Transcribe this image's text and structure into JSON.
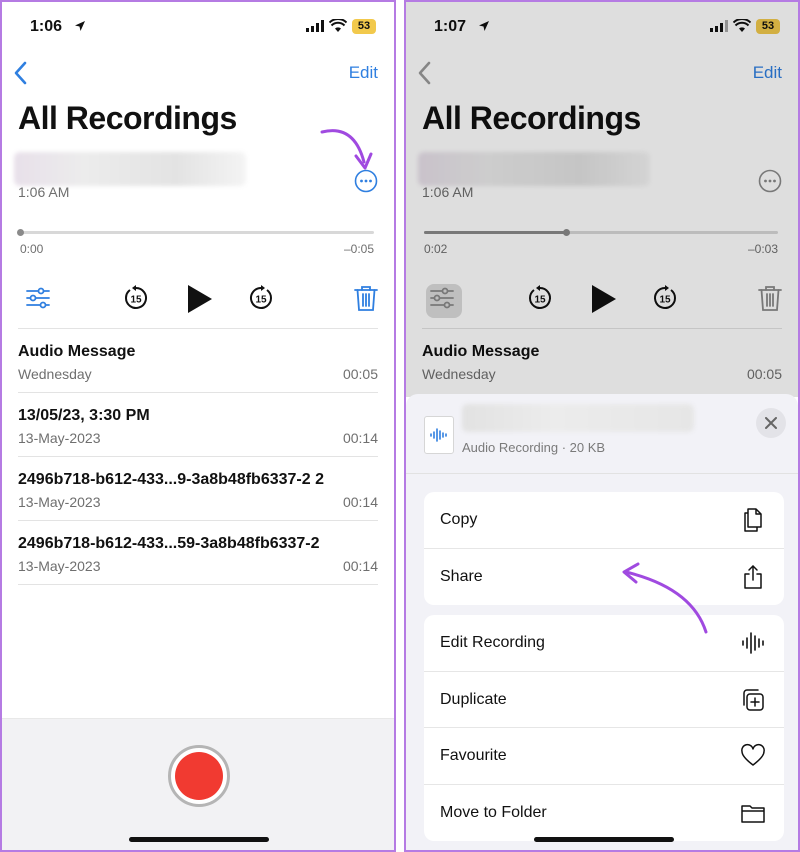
{
  "colors": {
    "accent": "#2f7fe0",
    "record": "#f13a31",
    "annotation": "#a04ae0",
    "battery": "#f2c94c"
  },
  "left": {
    "status": {
      "time": "1:06",
      "battery": "53"
    },
    "nav": {
      "edit_label": "Edit"
    },
    "title": "All Recordings",
    "current": {
      "time": "1:06 AM",
      "elapsed": "0:00",
      "remaining": "–0:05",
      "progress": 0
    },
    "recordings": [
      {
        "name": "Audio Message",
        "date": "Wednesday",
        "duration": "00:05"
      },
      {
        "name": "13/05/23, 3:30 PM",
        "date": "13-May-2023",
        "duration": "00:14"
      },
      {
        "name": "2496b718-b612-433...9-3a8b48fb6337-2 2",
        "date": "13-May-2023",
        "duration": "00:14"
      },
      {
        "name": "2496b718-b612-433...59-3a8b48fb6337-2",
        "date": "13-May-2023",
        "duration": "00:14"
      }
    ]
  },
  "right": {
    "status": {
      "time": "1:07",
      "battery": "53"
    },
    "nav": {
      "edit_label": "Edit"
    },
    "title": "All Recordings",
    "current": {
      "time": "1:06 AM",
      "elapsed": "0:02",
      "remaining": "–0:03",
      "progress": 0.4
    },
    "recordings": [
      {
        "name": "Audio Message",
        "date": "Wednesday",
        "duration": "00:05"
      }
    ],
    "sheet": {
      "file_meta": "Audio Recording · 20 KB",
      "group1": [
        {
          "label": "Copy",
          "icon": "copy-icon"
        },
        {
          "label": "Share",
          "icon": "share-icon"
        }
      ],
      "group2": [
        {
          "label": "Edit Recording",
          "icon": "waveform-icon"
        },
        {
          "label": "Duplicate",
          "icon": "duplicate-icon"
        },
        {
          "label": "Favourite",
          "icon": "heart-icon"
        },
        {
          "label": "Move to Folder",
          "icon": "folder-icon"
        }
      ]
    }
  }
}
